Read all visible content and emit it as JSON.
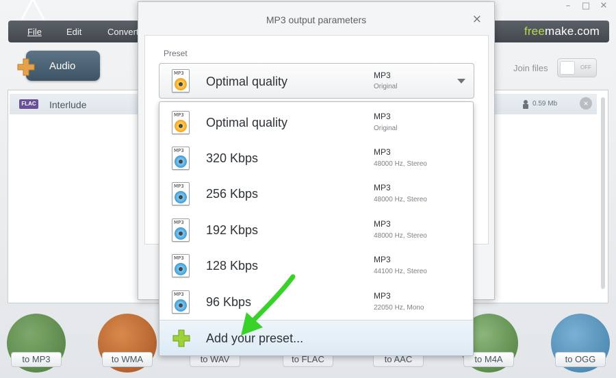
{
  "app": {
    "window_controls": {
      "minimize": "–",
      "maximize": "□",
      "close": "✕"
    },
    "menu": {
      "file": "File",
      "edit": "Edit",
      "convert": "Convert"
    },
    "brand": {
      "free": "free",
      "rest": "make.com"
    },
    "audio_button": "Audio",
    "join_files": {
      "label": "Join files",
      "state": "OFF"
    },
    "file_list": [
      {
        "badge": "FLAC",
        "name": "Interlude",
        "size": "0.59 Mb"
      }
    ],
    "format_buttons": [
      "to MP3",
      "to WMA",
      "to WAV",
      "to FLAC",
      "to AAC",
      "to M4A",
      "to OGG"
    ]
  },
  "dialog": {
    "title": "MP3 output parameters",
    "close": "×",
    "preset_label": "Preset",
    "selected": {
      "name": "Optimal quality",
      "format": "MP3",
      "detail": "Original",
      "icon": "orange"
    },
    "options": [
      {
        "name": "Optimal quality",
        "format": "MP3",
        "detail": "Original",
        "icon": "orange"
      },
      {
        "name": "320 Kbps",
        "format": "MP3",
        "detail": "48000 Hz,  Stereo",
        "icon": "blue"
      },
      {
        "name": "256 Kbps",
        "format": "MP3",
        "detail": "48000 Hz,  Stereo",
        "icon": "blue"
      },
      {
        "name": "192 Kbps",
        "format": "MP3",
        "detail": "48000 Hz,  Stereo",
        "icon": "blue"
      },
      {
        "name": "128 Kbps",
        "format": "MP3",
        "detail": "44100 Hz,  Stereo",
        "icon": "blue"
      },
      {
        "name": "96 Kbps",
        "format": "MP3",
        "detail": "22050 Hz,  Mono",
        "icon": "blue"
      }
    ],
    "add_preset": "Add your preset...",
    "file_icon_text": "MP3"
  },
  "colors": {
    "accent_green": "#b8d94a",
    "arrow_green": "#39d22a",
    "menubar": "#4e545a"
  }
}
